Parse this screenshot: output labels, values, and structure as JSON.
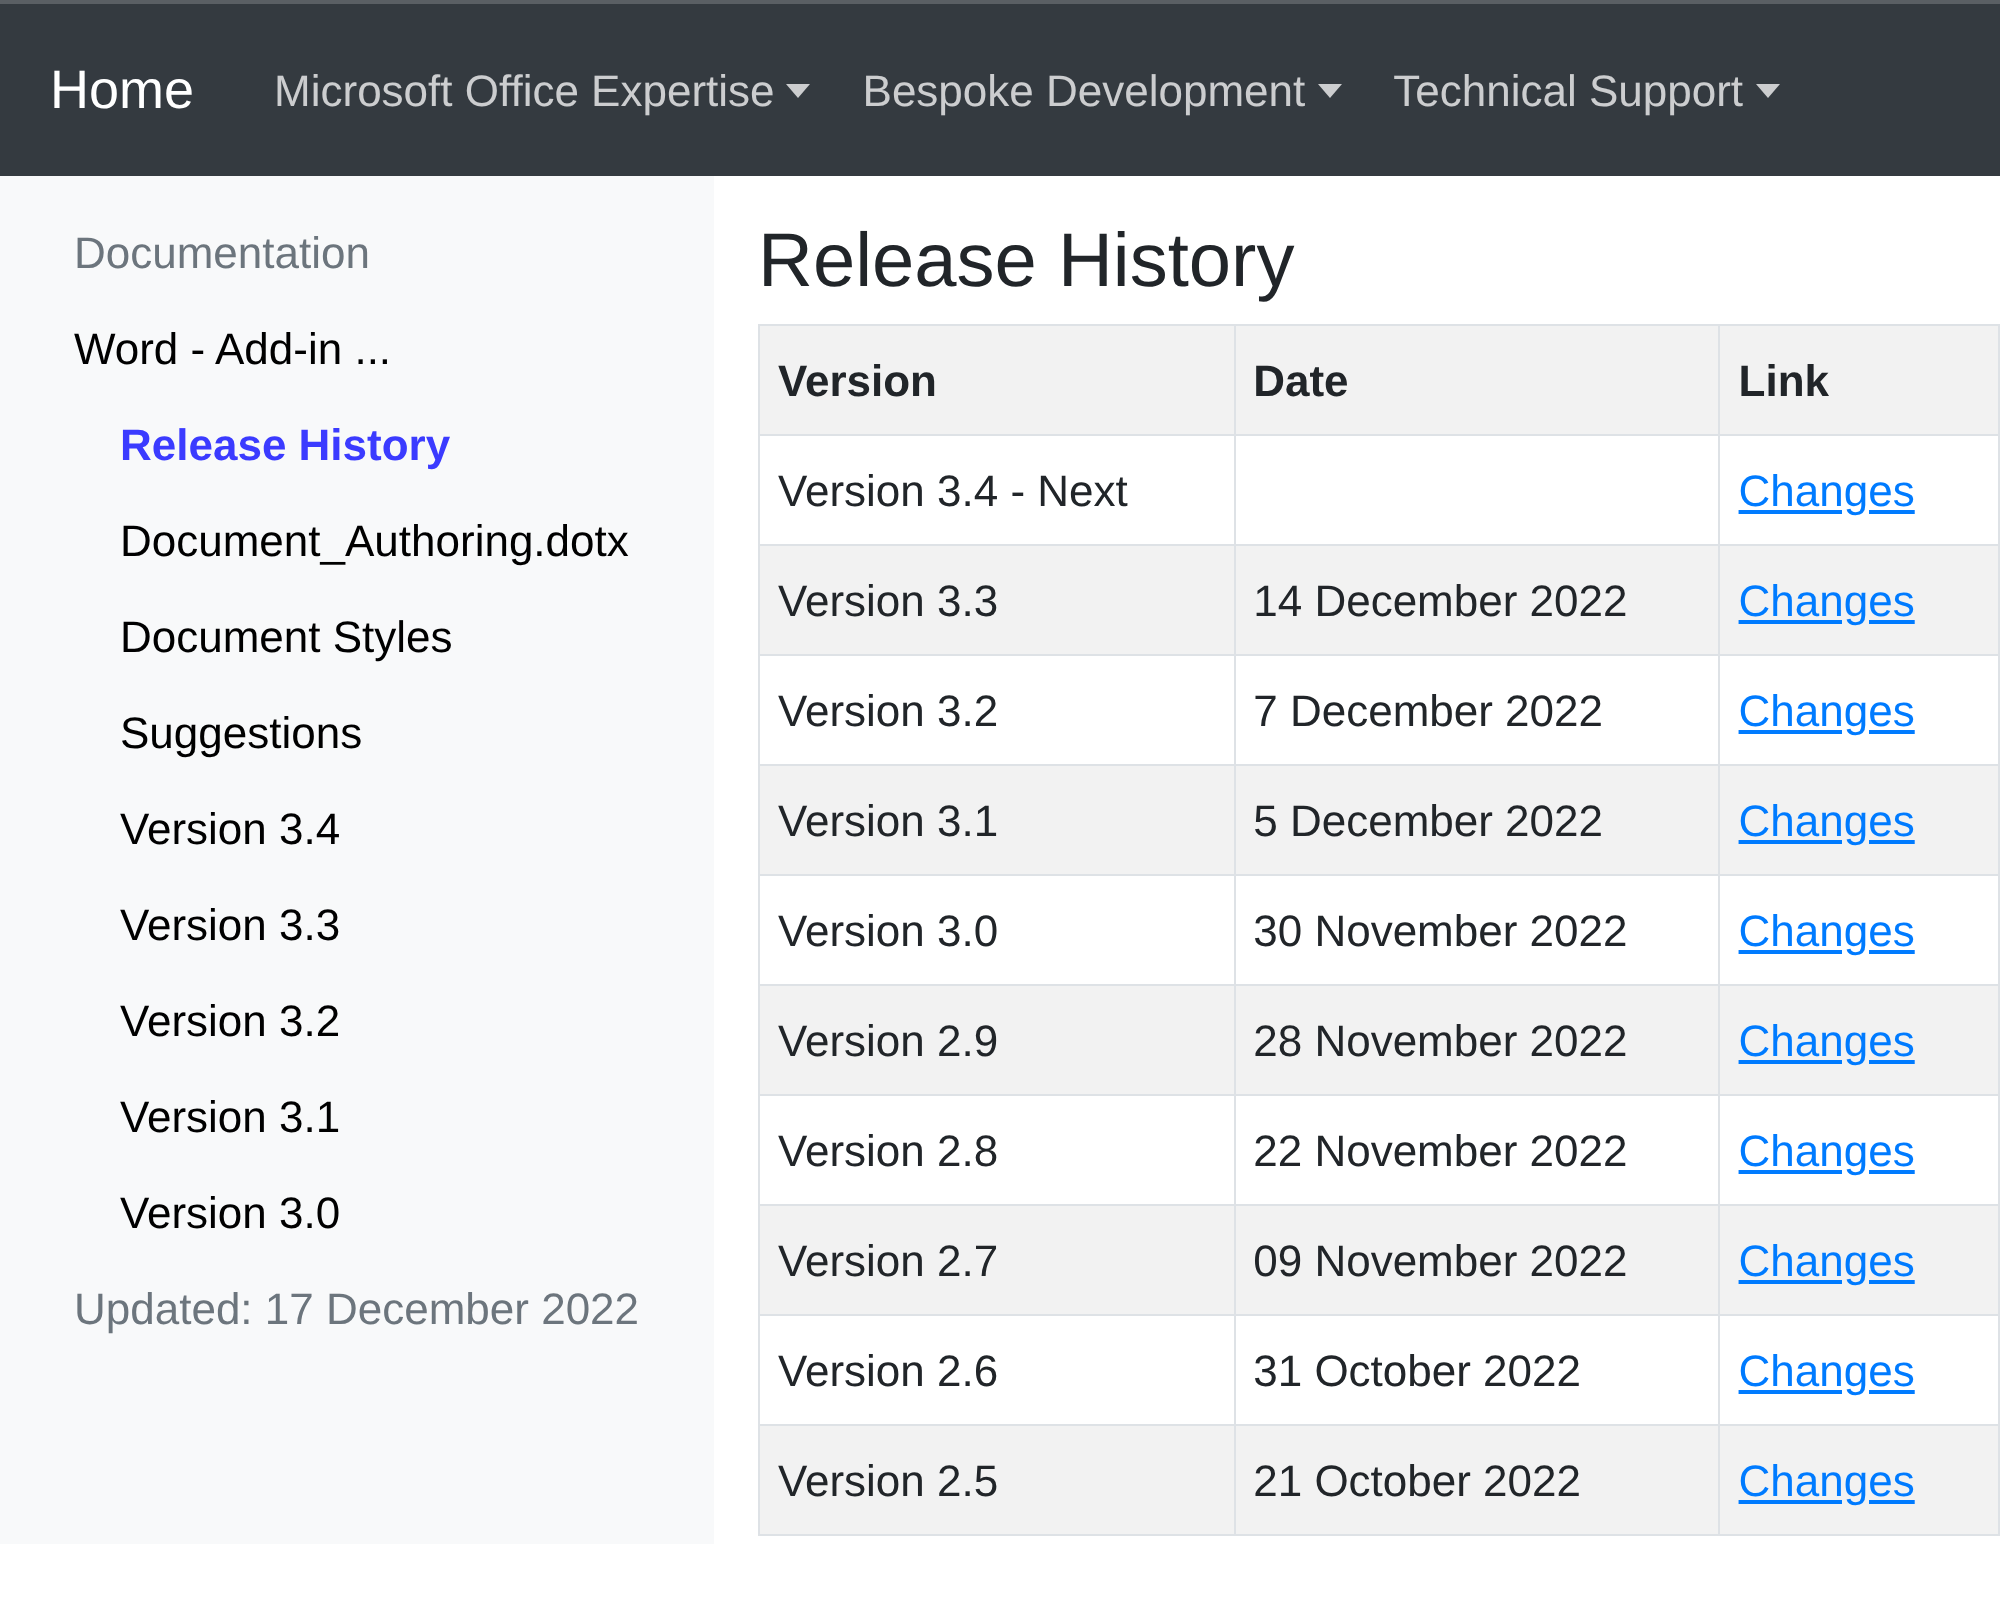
{
  "navbar": {
    "brand": "Home",
    "menus": [
      {
        "label": "Microsoft Office Expertise"
      },
      {
        "label": "Bespoke Development"
      },
      {
        "label": "Technical Support"
      }
    ]
  },
  "sidebar": {
    "heading": "Documentation",
    "items": [
      {
        "label": "Word - Add-in ...",
        "selected": false,
        "children": [
          {
            "label": "Release History",
            "selected": true
          },
          {
            "label": "Document_Authoring.dotx",
            "selected": false
          },
          {
            "label": "Document Styles",
            "selected": false
          },
          {
            "label": "Suggestions",
            "selected": false
          },
          {
            "label": "Version 3.4",
            "selected": false
          },
          {
            "label": "Version 3.3",
            "selected": false
          },
          {
            "label": "Version 3.2",
            "selected": false
          },
          {
            "label": "Version 3.1",
            "selected": false
          },
          {
            "label": "Version 3.0",
            "selected": false
          }
        ]
      }
    ],
    "updated": "Updated: 17 December 2022"
  },
  "main": {
    "title": "Release History",
    "table": {
      "columns": [
        "Version",
        "Date",
        "Link"
      ],
      "rows": [
        {
          "version": "Version 3.4 - Next",
          "link": "Changes"
        },
        {
          "version": "Version 3.3",
          "date": "14 December 2022",
          "link": "Changes"
        },
        {
          "version": "Version 3.2",
          "date": "7 December 2022",
          "link": "Changes"
        },
        {
          "version": "Version 3.1",
          "date": "5 December 2022",
          "link": "Changes"
        },
        {
          "version": "Version 3.0",
          "date": "30 November 2022",
          "link": "Changes"
        },
        {
          "version": "Version 2.9",
          "date": "28 November 2022",
          "link": "Changes"
        },
        {
          "version": "Version 2.8",
          "date": "22 November 2022",
          "link": "Changes"
        },
        {
          "version": "Version 2.7",
          "date": "09 November 2022",
          "link": "Changes"
        },
        {
          "version": "Version 2.6",
          "date": "31 October 2022",
          "link": "Changes"
        },
        {
          "version": "Version 2.5",
          "date": "21 October 2022",
          "link": "Changes"
        }
      ]
    }
  }
}
